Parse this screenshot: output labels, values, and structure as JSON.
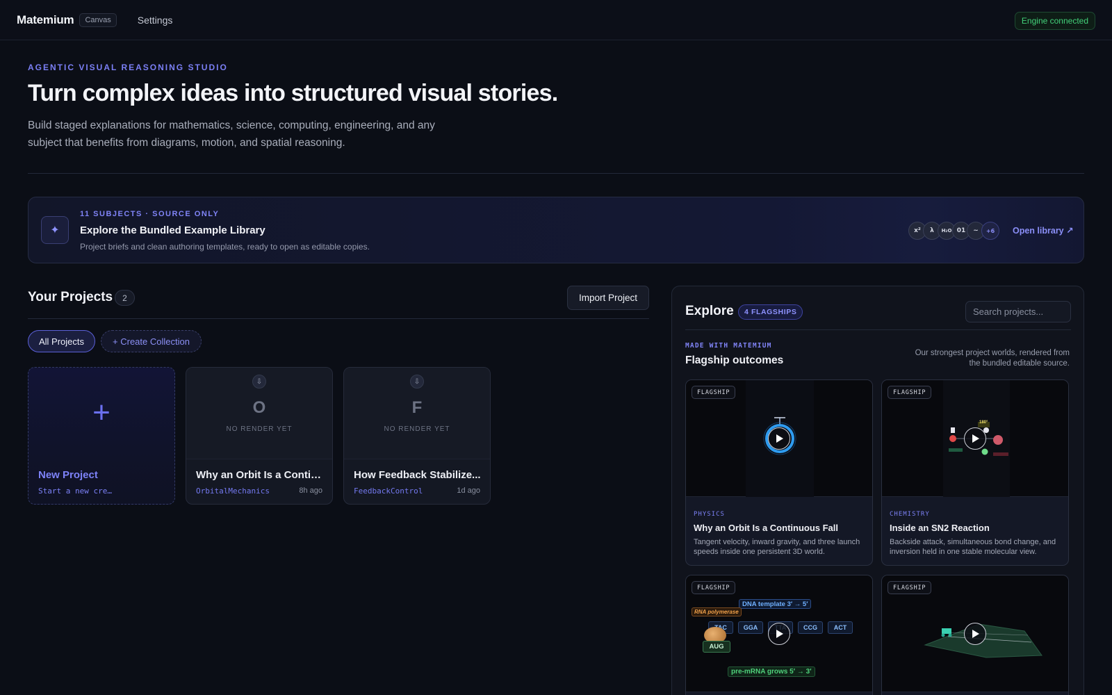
{
  "topbar": {
    "brand": "Matemium",
    "brand_tag": "Canvas",
    "nav_settings": "Settings",
    "status": "Engine connected"
  },
  "hero": {
    "eyebrow": "AGENTIC VISUAL REASONING STUDIO",
    "title": "Turn complex ideas into structured visual stories.",
    "description": "Build staged explanations for mathematics, science, computing, engineering, and any subject that benefits from diagrams, motion, and spatial reasoning."
  },
  "library": {
    "eyebrow": "11 SUBJECTS · SOURCE ONLY",
    "title": "Explore the Bundled Example Library",
    "description": "Project briefs and clean authoring templates, ready to open as editable copies.",
    "subjects": [
      "x²",
      "λ",
      "H₂O",
      "01",
      "~",
      "+6"
    ],
    "open_label": "Open library ↗",
    "icon": "sparkle-icon"
  },
  "projects": {
    "title": "Your Projects",
    "count": "2",
    "import_label": "Import Project",
    "filters": {
      "all": "All Projects",
      "create": "+ Create Collection"
    },
    "new_card": {
      "plus": "+",
      "title": "New Project",
      "subtitle": "Start a new cre…"
    },
    "items": [
      {
        "letter": "O",
        "placeholder": "NO RENDER YET",
        "title": "Why an Orbit Is a Contin...",
        "tag": "OrbitalMechanics",
        "time": "8h ago"
      },
      {
        "letter": "F",
        "placeholder": "NO RENDER YET",
        "title": "How Feedback Stabilize...",
        "tag": "FeedbackControl",
        "time": "1d ago"
      }
    ]
  },
  "explore": {
    "title": "Explore",
    "badge": "4 FLAGSHIPS",
    "search_placeholder": "Search projects...",
    "made_with": "MADE WITH MATEMIUM",
    "section_title": "Flagship outcomes",
    "section_note": "Our strongest project worlds, rendered from the bundled editable source.",
    "cards": [
      {
        "badge": "FLAGSHIP",
        "subject": "PHYSICS",
        "title": "Why an Orbit Is a Continuous Fall",
        "description": "Tangent velocity, inward gravity, and three launch speeds inside one persistent 3D world."
      },
      {
        "badge": "FLAGSHIP",
        "subject": "CHEMISTRY",
        "title": "Inside an SN2 Reaction",
        "description": "Backside attack, simultaneous bond change, and inversion held in one stable molecular view.",
        "angle_label": "180°"
      },
      {
        "badge": "FLAGSHIP",
        "rna_label": "RNA polymerase",
        "dna_label": "DNA template  3′ → 5′",
        "codons": [
          "TAC",
          "GGA",
          "TTA",
          "CCG",
          "ACT"
        ],
        "aug": "AUG",
        "mrna_label": "pre-mRNA grows  5′ → 3′"
      },
      {
        "badge": "FLAGSHIP"
      }
    ]
  },
  "colors": {
    "accent": "#7b7ff5",
    "status_green": "#43d17a",
    "background": "#0b0e16"
  }
}
